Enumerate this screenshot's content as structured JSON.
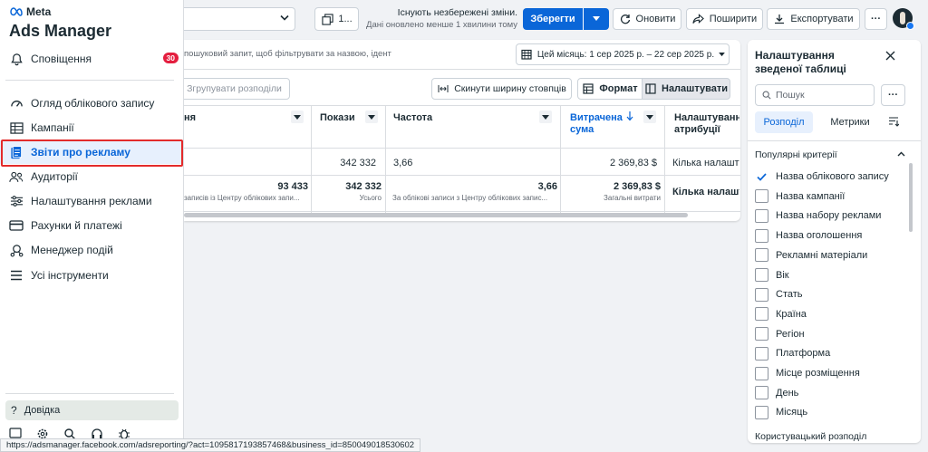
{
  "sidebar": {
    "logo_text": "Meta",
    "app_title": "Ads Manager",
    "notifications_label": "Сповіщення",
    "notifications_count": "30",
    "items": [
      {
        "label": "Огляд облікового запису",
        "icon": "gauge-icon"
      },
      {
        "label": "Кампанії",
        "icon": "table-icon"
      },
      {
        "label": "Звіти про рекламу",
        "icon": "report-icon",
        "active": true
      },
      {
        "label": "Аудиторії",
        "icon": "people-icon"
      },
      {
        "label": "Налаштування реклами",
        "icon": "sliders-icon"
      },
      {
        "label": "Рахунки й платежі",
        "icon": "card-icon"
      },
      {
        "label": "Менеджер подій",
        "icon": "events-icon"
      },
      {
        "label": "Усі інструменти",
        "icon": "menu-icon"
      }
    ],
    "help_label": "Довідка"
  },
  "toolbar": {
    "report_selector_label": "1...",
    "unsaved_title": "Існують незбережені зміни.",
    "unsaved_subtitle": "Дані оновлено менше 1 хвилини тому",
    "save_label": "Зберегти",
    "refresh_label": "Оновити",
    "share_label": "Поширити",
    "export_label": "Експортувати",
    "more_label": "···"
  },
  "filter": {
    "placeholder": "пошуковий запит, щоб фільтрувати за назвою, ідент",
    "date_range": "Цей місяць: 1 сер 2025 р. – 22 сер 2025 р."
  },
  "table_toolbar": {
    "group_label": "Згрупувати розподіли",
    "reset_width_label": "Скинути ширину стовпців",
    "format_label": "Формат",
    "settings_label": "Налаштувати"
  },
  "table": {
    "columns": [
      {
        "label": "ня"
      },
      {
        "label": "Покази"
      },
      {
        "label": "Частота"
      },
      {
        "label": "Витрачена сума",
        "sorted": true
      },
      {
        "label": "Налаштування атрибуції"
      }
    ],
    "row": {
      "impressions": "342 332",
      "frequency": "3,66",
      "spend": "2 369,83 $",
      "attribution": "Кількa налаштув"
    },
    "totals": {
      "reach": "93 433",
      "reach_sub": "записів із Центру облікових запи...",
      "impressions": "342 332",
      "impressions_sub": "Усього",
      "frequency": "3,66",
      "frequency_sub": "За облікові записи з Центру облікових запис...",
      "spend": "2 369,83 $",
      "spend_sub": "Загальні витрати",
      "attribution": "Кількa налашт"
    }
  },
  "panel": {
    "title": "Налаштування зведеної таблиці",
    "search_placeholder": "Пошук",
    "tab_breakdown": "Розподіл",
    "tab_metrics": "Метрики",
    "section_title": "Популярні критерії",
    "criteria": [
      {
        "label": "Назва облікового запису",
        "checked": true
      },
      {
        "label": "Назва кампанії",
        "checked": false
      },
      {
        "label": "Назва набору реклами",
        "checked": false
      },
      {
        "label": "Назва оголошення",
        "checked": false
      },
      {
        "label": "Рекламні матеріали",
        "checked": false
      },
      {
        "label": "Вік",
        "checked": false
      },
      {
        "label": "Стать",
        "checked": false
      },
      {
        "label": "Країна",
        "checked": false
      },
      {
        "label": "Регіон",
        "checked": false
      },
      {
        "label": "Платформа",
        "checked": false
      },
      {
        "label": "Місце розміщення",
        "checked": false
      },
      {
        "label": "День",
        "checked": false
      },
      {
        "label": "Місяць",
        "checked": false
      }
    ],
    "next_section": "Користувацький розподіл"
  },
  "statusbar": {
    "url": "https://adsmanager.facebook.com/adsreporting/?act=1095817193857468&business_id=850049018530602"
  },
  "colors": {
    "primary": "#0a66d8",
    "active_bg": "#e7f0fd",
    "badge": "#e41e3f",
    "highlight": "#e32b2b"
  }
}
